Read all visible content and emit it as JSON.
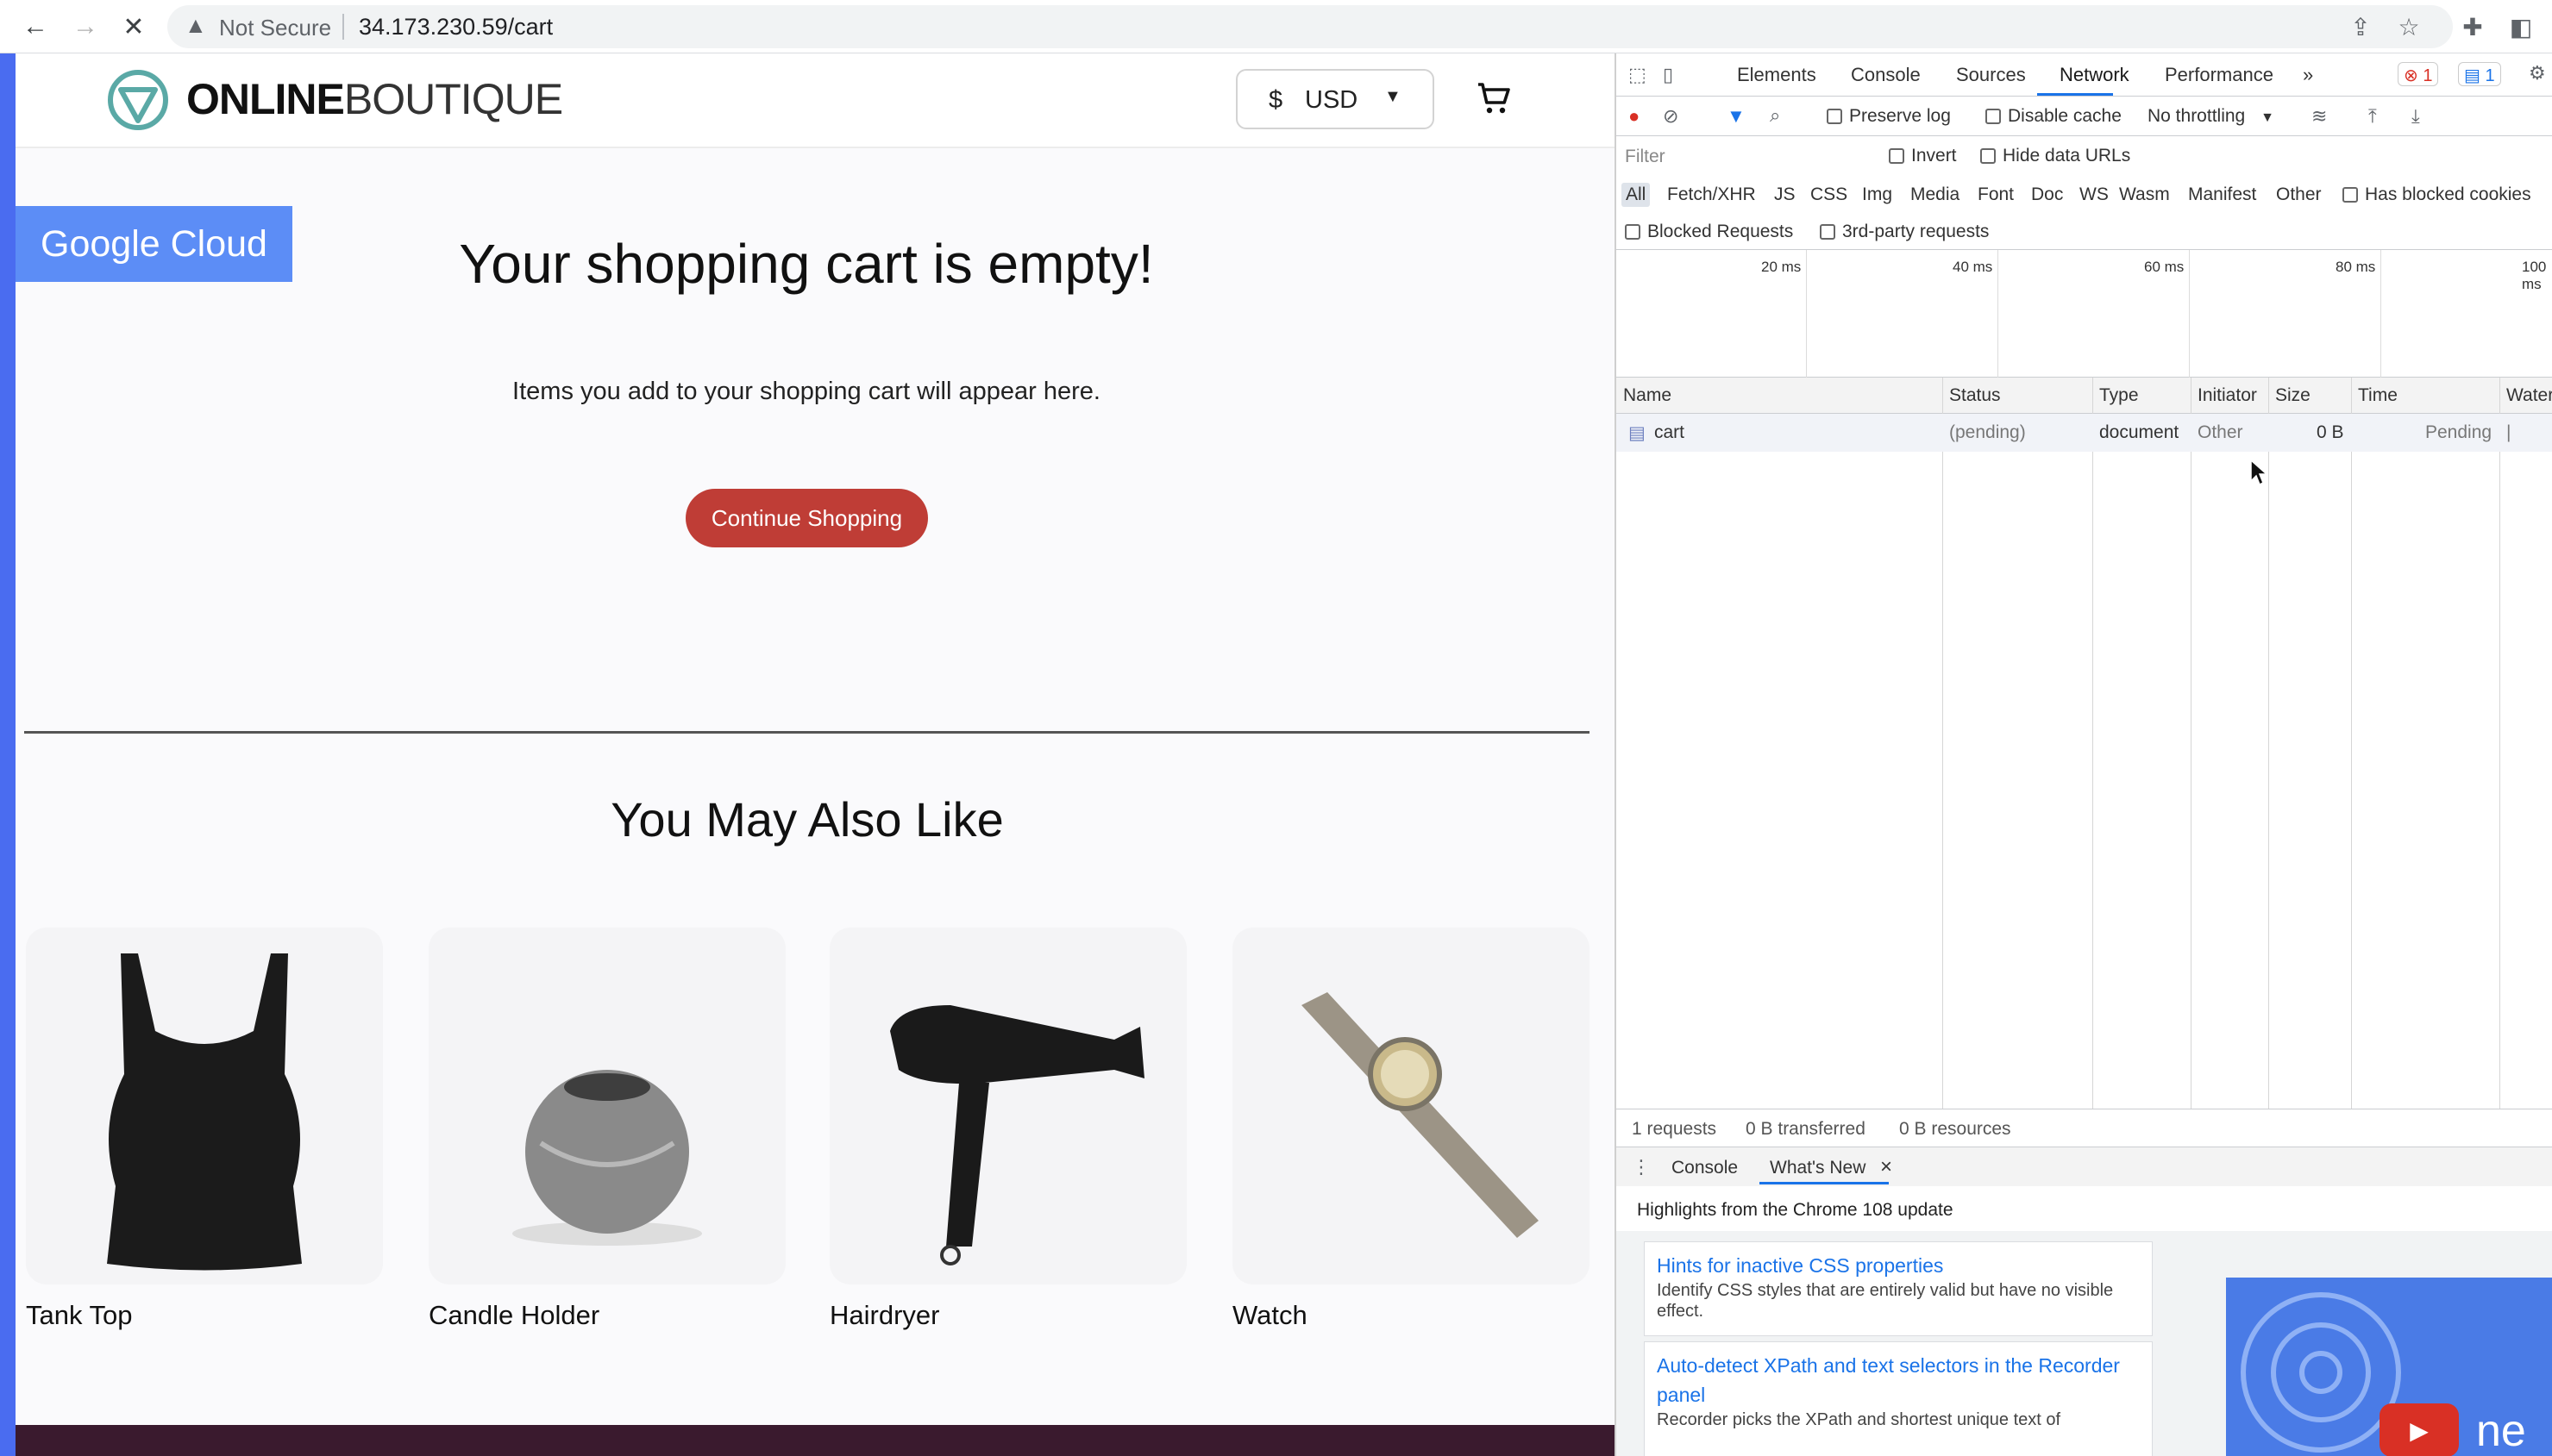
{
  "browser": {
    "omnibox": {
      "security_label": "Not Secure",
      "url": "34.173.230.59/cart"
    }
  },
  "site": {
    "logo": {
      "bold": "ONLINE",
      "thin": "BOUTIQUE"
    },
    "currency": {
      "symbol": "$",
      "code": "USD"
    },
    "google_cloud_badge": "Google Cloud",
    "empty_title": "Your shopping cart is empty!",
    "empty_subtitle": "Items you add to your shopping cart will appear here.",
    "continue_button": "Continue Shopping",
    "also_like_heading": "You May Also Like",
    "products": [
      {
        "name": "Tank Top"
      },
      {
        "name": "Candle Holder"
      },
      {
        "name": "Hairdryer"
      },
      {
        "name": "Watch"
      }
    ],
    "colors": {
      "accent": "#bf3d36",
      "badge": "#5c8df6",
      "left_strip": "#4a6cf0"
    }
  },
  "devtools": {
    "tabs": [
      "Elements",
      "Console",
      "Sources",
      "Network",
      "Performance"
    ],
    "active_tab": "Network",
    "more_tabs": "»",
    "error_count": "1",
    "message_count": "1",
    "toolbar": {
      "preserve_log": "Preserve log",
      "disable_cache": "Disable cache",
      "throttling": "No throttling"
    },
    "filter": {
      "placeholder": "Filter",
      "invert": "Invert",
      "hide_data_urls": "Hide data URLs"
    },
    "types": [
      "All",
      "Fetch/XHR",
      "JS",
      "CSS",
      "Img",
      "Media",
      "Font",
      "Doc",
      "WS",
      "Wasm",
      "Manifest",
      "Other"
    ],
    "has_blocked_cookies": "Has blocked cookies",
    "blocked_requests": "Blocked Requests",
    "third_party": "3rd-party requests",
    "overview_ticks": [
      "20 ms",
      "40 ms",
      "60 ms",
      "80 ms",
      "100 ms"
    ],
    "columns": [
      "Name",
      "Status",
      "Type",
      "Initiator",
      "Size",
      "Time",
      "Waterfall"
    ],
    "rows": [
      {
        "name": "cart",
        "status": "(pending)",
        "type": "document",
        "initiator": "Other",
        "size": "0 B",
        "time": "Pending"
      }
    ],
    "status_bar": {
      "requests": "1 requests",
      "transferred": "0 B transferred",
      "resources": "0 B resources"
    },
    "drawer": {
      "tabs": [
        "Console",
        "What's New"
      ],
      "close": "×",
      "highlights": "Highlights from the Chrome 108 update",
      "cards": [
        {
          "title": "Hints for inactive CSS properties",
          "desc": "Identify CSS styles that are entirely valid but have no visible effect."
        },
        {
          "title": "Auto-detect XPath and text selectors in the Recorder panel",
          "desc": "Recorder picks the XPath and shortest unique text of"
        }
      ],
      "video_text": "ne"
    }
  }
}
